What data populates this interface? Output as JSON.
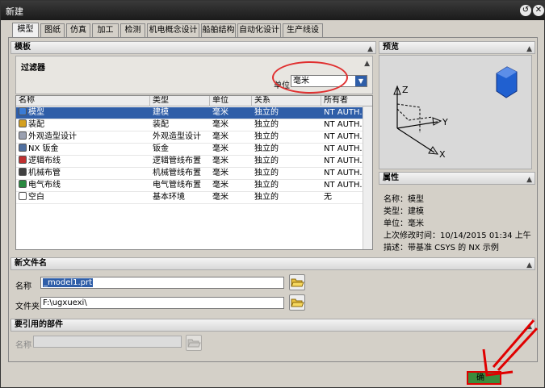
{
  "window": {
    "title": "新建"
  },
  "tabs": [
    {
      "label": "模型",
      "active": true
    },
    {
      "label": "图纸"
    },
    {
      "label": "仿真"
    },
    {
      "label": "加工"
    },
    {
      "label": "检测"
    },
    {
      "label": "机电概念设计"
    },
    {
      "label": "船舶结构"
    },
    {
      "label": "自动化设计"
    },
    {
      "label": "生产线设计"
    }
  ],
  "templates": {
    "header": "模板",
    "filter": {
      "header": "过滤器",
      "unit_label": "单位",
      "unit_value": "毫米"
    },
    "columns": [
      "名称",
      "类型",
      "单位",
      "关系",
      "所有者"
    ],
    "rows": [
      {
        "icon": "model-icon",
        "name": "模型",
        "type": "建模",
        "unit": "毫米",
        "relation": "独立的",
        "owner": "NT AUTH...",
        "selected": true
      },
      {
        "icon": "assembly-icon",
        "name": "装配",
        "type": "装配",
        "unit": "毫米",
        "relation": "独立的",
        "owner": "NT AUTH..."
      },
      {
        "icon": "shape-studio-icon",
        "name": "外观造型设计",
        "type": "外观造型设计",
        "unit": "毫米",
        "relation": "独立的",
        "owner": "NT AUTH..."
      },
      {
        "icon": "sheet-metal-icon",
        "name": "NX 钣金",
        "type": "钣金",
        "unit": "毫米",
        "relation": "独立的",
        "owner": "NT AUTH..."
      },
      {
        "icon": "logical-routing-icon",
        "name": "逻辑布线",
        "type": "逻辑管线布置",
        "unit": "毫米",
        "relation": "独立的",
        "owner": "NT AUTH..."
      },
      {
        "icon": "mechanical-routing-icon",
        "name": "机械布管",
        "type": "机械管线布置",
        "unit": "毫米",
        "relation": "独立的",
        "owner": "NT AUTH..."
      },
      {
        "icon": "electrical-routing-icon",
        "name": "电气布线",
        "type": "电气管线布置",
        "unit": "毫米",
        "relation": "独立的",
        "owner": "NT AUTH..."
      },
      {
        "icon": "blank-icon",
        "name": "空白",
        "type": "基本环境",
        "unit": "毫米",
        "relation": "独立的",
        "owner": "无"
      }
    ]
  },
  "preview": {
    "header": "预览",
    "axis_x": "X",
    "axis_y": "Y",
    "axis_z": "Z"
  },
  "properties": {
    "header": "属性",
    "lines": [
      "名称：模型",
      "类型：建模",
      "单位：毫米",
      "上次修改时间：10/14/2015 01:34 上午",
      "描述：带基准 CSYS 的 NX 示例"
    ]
  },
  "new_file": {
    "header": "新文件名",
    "name_label": "名称",
    "name_value": "_model1.prt",
    "folder_label": "文件夹",
    "folder_value": "F:\\ugxuexi\\"
  },
  "referenced_part": {
    "header": "要引用的部件",
    "name_label": "名称",
    "name_value": ""
  },
  "footer": {
    "ok_label": "确"
  },
  "colors": {
    "selection": "#2f5ea8",
    "annotation_red": "#e00000",
    "ok_button": "#3c8c3c"
  }
}
